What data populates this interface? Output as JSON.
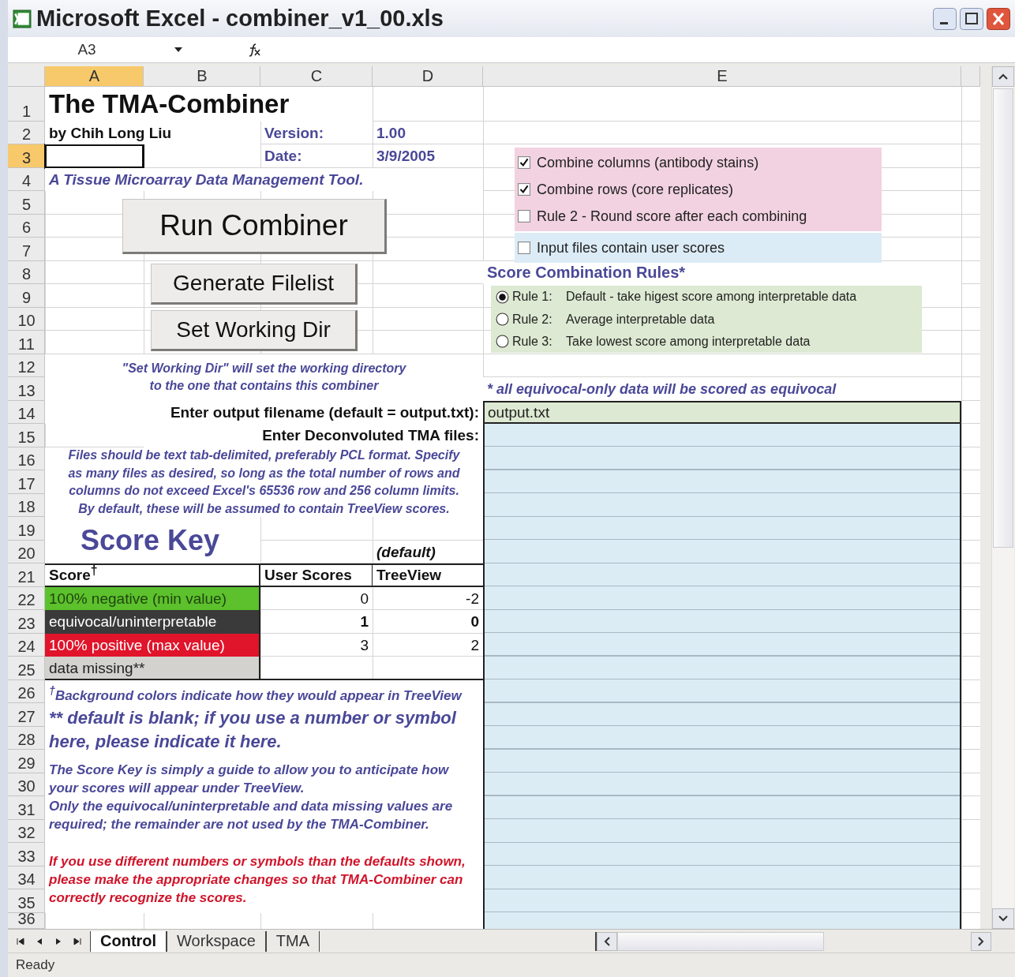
{
  "window": {
    "title": "Microsoft Excel - combiner_v1_00.xls"
  },
  "formula_bar": {
    "name_box": "A3"
  },
  "columns": [
    {
      "label": "A",
      "selected": true
    },
    {
      "label": "B",
      "selected": false
    },
    {
      "label": "C",
      "selected": false
    },
    {
      "label": "D",
      "selected": false
    },
    {
      "label": "E",
      "selected": false
    }
  ],
  "rows": [
    {
      "label": "1",
      "selected": false
    },
    {
      "label": "2",
      "selected": false
    },
    {
      "label": "3",
      "selected": true
    },
    {
      "label": "4",
      "selected": false
    },
    {
      "label": "5",
      "selected": false
    },
    {
      "label": "6",
      "selected": false
    },
    {
      "label": "7",
      "selected": false
    },
    {
      "label": "8",
      "selected": false
    },
    {
      "label": "9",
      "selected": false
    },
    {
      "label": "10",
      "selected": false
    },
    {
      "label": "11",
      "selected": false
    },
    {
      "label": "12",
      "selected": false
    },
    {
      "label": "13",
      "selected": false
    },
    {
      "label": "14",
      "selected": false
    },
    {
      "label": "15",
      "selected": false
    },
    {
      "label": "16",
      "selected": false
    },
    {
      "label": "17",
      "selected": false
    },
    {
      "label": "18",
      "selected": false
    },
    {
      "label": "19",
      "selected": false
    },
    {
      "label": "20",
      "selected": false
    },
    {
      "label": "21",
      "selected": false
    },
    {
      "label": "22",
      "selected": false
    },
    {
      "label": "23",
      "selected": false
    },
    {
      "label": "24",
      "selected": false
    },
    {
      "label": "25",
      "selected": false
    },
    {
      "label": "26",
      "selected": false
    },
    {
      "label": "27",
      "selected": false
    },
    {
      "label": "28",
      "selected": false
    },
    {
      "label": "29",
      "selected": false
    },
    {
      "label": "30",
      "selected": false
    },
    {
      "label": "31",
      "selected": false
    },
    {
      "label": "32",
      "selected": false
    },
    {
      "label": "33",
      "selected": false
    },
    {
      "label": "34",
      "selected": false
    },
    {
      "label": "35",
      "selected": false
    },
    {
      "label": "36",
      "selected": false
    }
  ],
  "sheet": {
    "title": "The TMA-Combiner",
    "author": "by Chih Long Liu",
    "version_label": "Version:",
    "version": "1.00",
    "date_label": "Date:",
    "date": "3/9/2005",
    "tagline": "A Tissue Microarray Data Management Tool.",
    "buttons": [
      "Run Combiner",
      "Generate Filelist",
      "Set Working Dir"
    ],
    "working_dir_note": [
      "\"Set Working Dir\" will set the working directory",
      "to the one that contains this combiner"
    ],
    "option_groups": [
      {
        "color": "#f2d2e0",
        "items": [
          {
            "label": "Combine columns (antibody stains)",
            "checked": true
          },
          {
            "label": "Combine rows (core replicates)",
            "checked": true
          },
          {
            "label": "Rule 2 - Round score after each combining",
            "checked": false
          }
        ]
      },
      {
        "color": "#dcecf6",
        "items": [
          {
            "label": "Input files contain user scores",
            "checked": false
          }
        ]
      }
    ],
    "rules_heading": "Score Combination Rules*",
    "rules": [
      {
        "label": "Rule 1:",
        "text": "Default - take higest score among interpretable data",
        "selected": true
      },
      {
        "label": "Rule 2:",
        "text": "Average interpretable data",
        "selected": false
      },
      {
        "label": "Rule 3:",
        "text": "Take lowest score among interpretable data",
        "selected": false
      }
    ],
    "rules_footnote": "* all equivocal-only data will be scored as equivocal",
    "output_label": "Enter output filename (default = output.txt):",
    "output_value": "output.txt",
    "files_label": "Enter Deconvoluted TMA files:",
    "files_note": [
      "Files should be text tab-delimited, preferably PCL format.  Specify",
      "as many files as desired, so long as the total number of rows and",
      "columns do not exceed Excel's 65536 row and 256 column limits.",
      "By default, these will be assumed to contain TreeView scores."
    ],
    "score_key": {
      "title": "Score Key",
      "default_label": "(default)",
      "headers": [
        "Score$^{†}$",
        "User Scores",
        "TreeView"
      ],
      "rows": [
        {
          "label": "100% negative (min value)",
          "color": "#5cc12c",
          "user": "0",
          "treeview": "-2",
          "bold": false
        },
        {
          "label": "equivocal/uninterpretable",
          "color": "#3a3a3a",
          "user": "1",
          "treeview": "0",
          "bold": true
        },
        {
          "label": "100% positive (max value)",
          "color": "#e0142a",
          "user": "3",
          "treeview": "2",
          "bold": false
        },
        {
          "label": "data missing**",
          "color": "#d4d2ce"
        }
      ]
    },
    "notes": [
      {
        "kind": "footnote",
        "lines": [
          "$^{†}$Background colors indicate how they would appear in TreeView"
        ]
      },
      {
        "kind": "large",
        "lines": [
          "** default is blank; if you use a number or symbol",
          "here, please indicate it here."
        ]
      },
      {
        "kind": "info",
        "lines": [
          "The Score Key is simply a guide to allow you to anticipate how",
          "your scores will appear under TreeView.",
          "Only the equivocal/uninterpretable and data missing values are",
          "required; the remainder are not used by the TMA-Combiner."
        ]
      },
      {
        "kind": "warning",
        "lines": [
          "If you use different numbers or symbols than the defaults shown,",
          "please make the appropriate changes so that TMA-Combiner can",
          "correctly recognize the scores."
        ]
      }
    ]
  },
  "sheet_tabs": [
    {
      "label": "Control",
      "selected": true
    },
    {
      "label": "Workspace",
      "selected": false
    },
    {
      "label": "TMA",
      "selected": false
    }
  ],
  "status_bar": "Ready"
}
